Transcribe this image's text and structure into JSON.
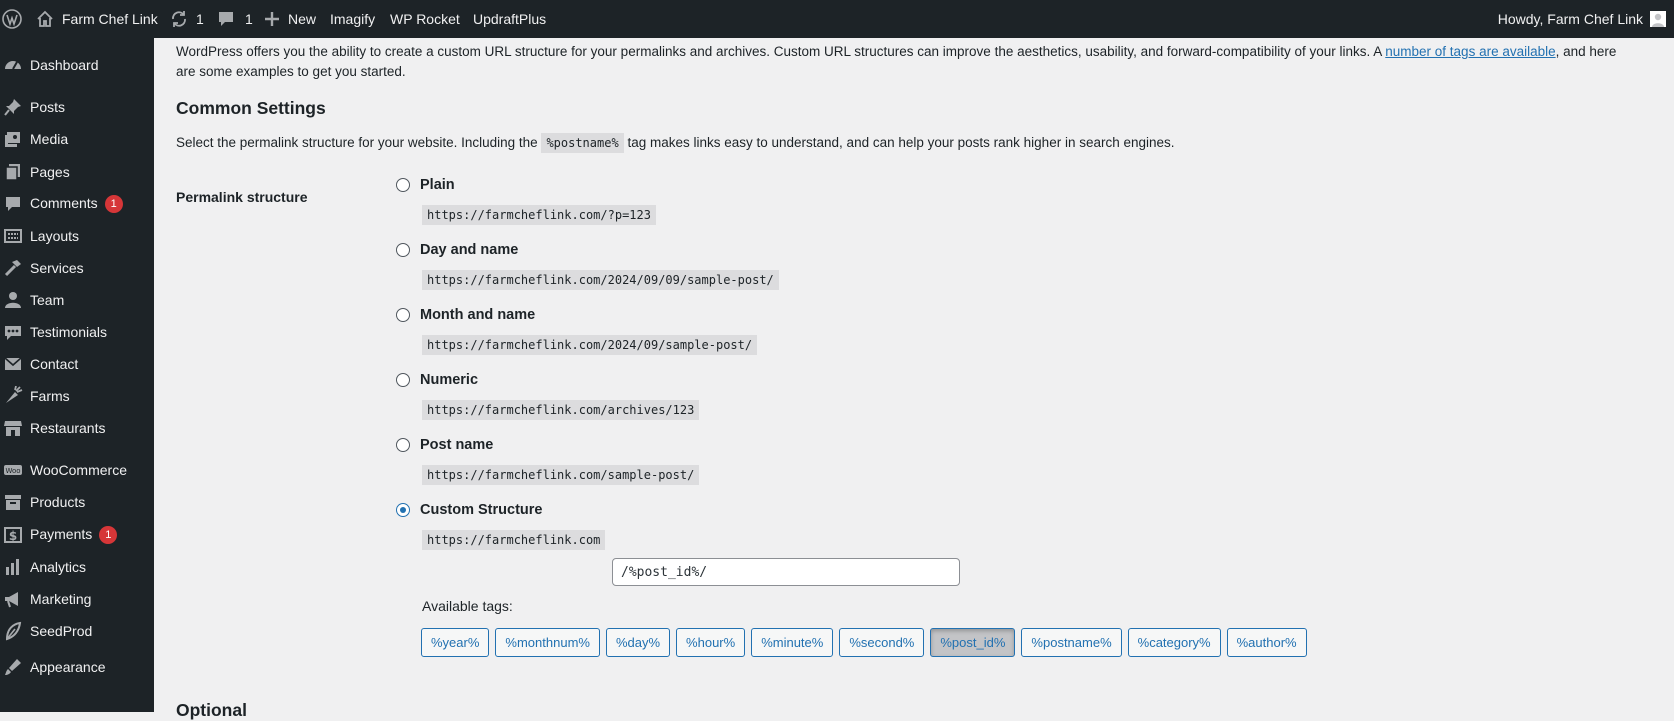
{
  "admin_bar": {
    "site_name": "Farm Chef Link",
    "updates_count": "1",
    "comments_count": "1",
    "new_label": "New",
    "plugins": [
      "Imagify",
      "WP Rocket",
      "UpdraftPlus"
    ],
    "greeting": "Howdy, Farm Chef Link"
  },
  "sidebar": {
    "items": [
      {
        "label": "Dashboard",
        "icon": "dashboard-icon"
      },
      {
        "label": "Posts",
        "icon": "pin-icon"
      },
      {
        "label": "Media",
        "icon": "media-icon"
      },
      {
        "label": "Pages",
        "icon": "pages-icon"
      },
      {
        "label": "Comments",
        "icon": "comment-icon",
        "badge": "1"
      },
      {
        "label": "Layouts",
        "icon": "layout-icon"
      },
      {
        "label": "Services",
        "icon": "hammer-icon"
      },
      {
        "label": "Team",
        "icon": "person-icon"
      },
      {
        "label": "Testimonials",
        "icon": "testimonial-icon"
      },
      {
        "label": "Contact",
        "icon": "email-icon"
      },
      {
        "label": "Farms",
        "icon": "carrot-icon"
      },
      {
        "label": "Restaurants",
        "icon": "store-icon"
      },
      {
        "label": "WooCommerce",
        "icon": "woo-icon"
      },
      {
        "label": "Products",
        "icon": "archive-icon"
      },
      {
        "label": "Payments",
        "icon": "dollar-icon",
        "badge": "1"
      },
      {
        "label": "Analytics",
        "icon": "bar-chart-icon"
      },
      {
        "label": "Marketing",
        "icon": "megaphone-icon"
      },
      {
        "label": "SeedProd",
        "icon": "seed-icon"
      },
      {
        "label": "Appearance",
        "icon": "brush-icon"
      }
    ]
  },
  "main": {
    "intro_text": "WordPress offers you the ability to create a custom URL structure for your permalinks and archives. Custom URL structures can improve the aesthetics, usability, and forward-compatibility of your links. A ",
    "intro_link": "number of tags are available",
    "intro_tail_1": ", and here",
    "intro_tail_2": "are some examples to get you started.",
    "section_title": "Common Settings",
    "desc_before": "Select the permalink structure for your website. Including the ",
    "desc_code": "%postname%",
    "desc_after": " tag makes links easy to understand, and can help your posts rank higher in search engines.",
    "permalink_label": "Permalink structure",
    "options": [
      {
        "label": "Plain",
        "example": "https://farmcheflink.com/?p=123",
        "checked": false
      },
      {
        "label": "Day and name",
        "example": "https://farmcheflink.com/2024/09/09/sample-post/",
        "checked": false
      },
      {
        "label": "Month and name",
        "example": "https://farmcheflink.com/2024/09/sample-post/",
        "checked": false
      },
      {
        "label": "Numeric",
        "example": "https://farmcheflink.com/archives/123",
        "checked": false
      },
      {
        "label": "Post name",
        "example": "https://farmcheflink.com/sample-post/",
        "checked": false
      },
      {
        "label": "Custom Structure",
        "example": "https://farmcheflink.com",
        "checked": true
      }
    ],
    "custom_value": "/%post_id%/",
    "available_tags_label": "Available tags:",
    "tags": [
      "%year%",
      "%monthnum%",
      "%day%",
      "%hour%",
      "%minute%",
      "%second%",
      "%post_id%",
      "%postname%",
      "%category%",
      "%author%"
    ],
    "active_tag": "%post_id%",
    "optional_heading": "Optional"
  }
}
